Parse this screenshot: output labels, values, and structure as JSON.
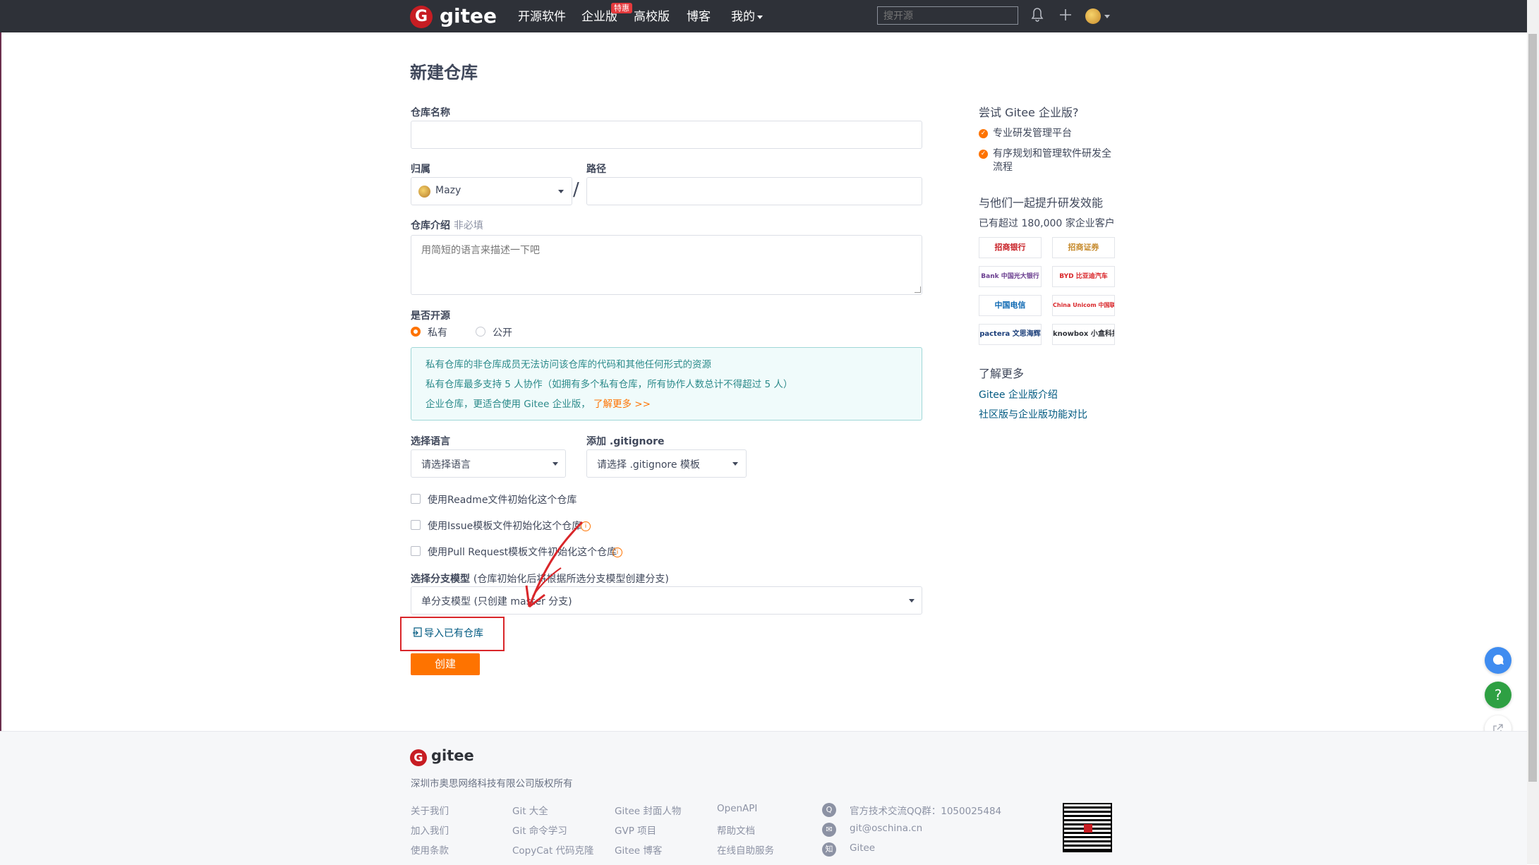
{
  "header": {
    "logo_text": "gitee",
    "logo_glyph": "G",
    "nav": [
      "开源软件",
      "企业版",
      "高校版",
      "博客",
      "我的"
    ],
    "badge": "特惠",
    "search_placeholder": "搜开源"
  },
  "page": {
    "title": "新建仓库",
    "repo_name_label": "仓库名称",
    "repo_name_value": "",
    "owner_label": "归属",
    "owner_value": "Mazy",
    "path_label": "路径",
    "path_value": "",
    "slash": "/",
    "desc_label": "仓库介绍",
    "desc_optional": "非必填",
    "desc_placeholder": "用简短的语言来描述一下吧",
    "open_label": "是否开源",
    "private_label": "私有",
    "public_label": "公开",
    "private_selected": true,
    "info_lines": [
      "私有仓库的非仓库成员无法访问该仓库的代码和其他任何形式的资源",
      "私有仓库最多支持 5 人协作（如拥有多个私有仓库，所有协作人数总计不得超过 5 人）",
      "企业仓库，更适合使用 Gitee 企业版，"
    ],
    "info_link": "了解更多 >>",
    "language_label": "选择语言",
    "language_value": "请选择语言",
    "gitignore_label": "添加 .gitignore",
    "gitignore_value": "请选择 .gitignore 模板",
    "checkbox_readme": "使用Readme文件初始化这个仓库",
    "checkbox_issue": "使用Issue模板文件初始化这个仓库",
    "checkbox_pr": "使用Pull Request模板文件初始化这个仓库",
    "branch_label": "选择分支模型",
    "branch_hint": "(仓库初始化后将根据所选分支模型创建分支)",
    "branch_value": "单分支模型 (只创建 master 分支)",
    "import_link": "导入已有仓库",
    "create_button": "创建"
  },
  "sidebar": {
    "try_title": "尝试 Gitee 企业版?",
    "features": [
      "专业研发管理平台",
      "有序规划和管理软件研发全流程"
    ],
    "together_title": "与他们一起提升研发效能",
    "customers_text": "已有超过 180,000 家企业客户",
    "logos": [
      "招商银行",
      "招商证券",
      "Bank 中国光大银行",
      "BYD 比亚迪汽车",
      "中国电信",
      "China Unicom 中国联通",
      "pactera 文思海辉",
      "knowbox 小盒科技"
    ],
    "learn_title": "了解更多",
    "links": [
      "Gitee 企业版介绍",
      "社区版与企业版功能对比"
    ]
  },
  "footer": {
    "logo_text": "gitee",
    "company": "深圳市奥思网络科技有限公司版权所有",
    "col1": [
      "关于我们",
      "加入我们",
      "使用条款"
    ],
    "col2": [
      "Git 大全",
      "Git 命令学习",
      "CopyCat 代码克隆"
    ],
    "col3": [
      "Gitee 封面人物",
      "GVP 项目",
      "Gitee 博客"
    ],
    "col4": [
      "OpenAPI",
      "帮助文档",
      "在线自助服务"
    ],
    "contacts": [
      "官方技术交流QQ群：1050025484",
      "git@oschina.cn",
      "Gitee"
    ]
  },
  "colors": {
    "accent": "#fe7300",
    "topbar": "#2e3138",
    "link": "#005980",
    "annotation_red": "#d9262a"
  },
  "icons": [
    "gitee-logo-icon",
    "bell-icon",
    "plus-icon",
    "avatar-icon",
    "info-icon",
    "import-icon",
    "check-icon",
    "chat-icon",
    "help-icon",
    "share-icon",
    "qq-icon",
    "mail-icon",
    "zhihu-icon",
    "qrcode-icon"
  ]
}
